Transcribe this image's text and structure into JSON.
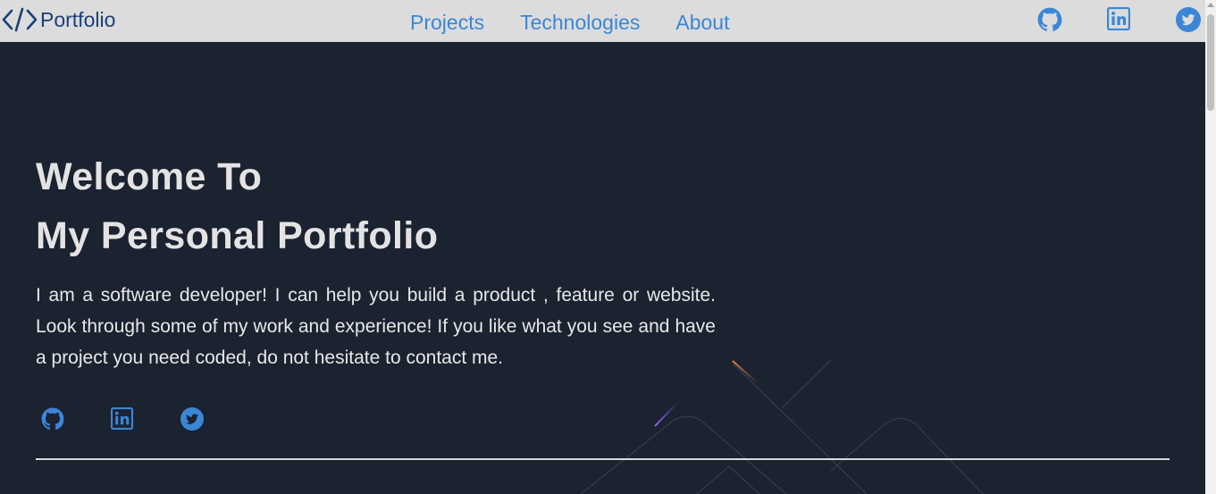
{
  "header": {
    "logo_text": "Portfolio",
    "nav": [
      "Projects",
      "Technologies",
      "About"
    ],
    "social_icons": [
      "github-icon",
      "linkedin-icon",
      "twitter-icon"
    ]
  },
  "hero": {
    "title_line1": "Welcome To",
    "title_line2": "My Personal Portfolio",
    "intro": "I am a software developer! I can help you build a product , feature or website. Look through some of my work and experience! If you like what you see and have a project you need coded, do not hesitate to contact me.",
    "social_icons": [
      "github-icon",
      "linkedin-icon",
      "twitter-icon"
    ]
  },
  "colors": {
    "header_bg": "#dcdcdc",
    "page_bg": "#1b2230",
    "link": "#3b86d6",
    "logo": "#1c3f7a",
    "text": "#e3e3e3"
  }
}
